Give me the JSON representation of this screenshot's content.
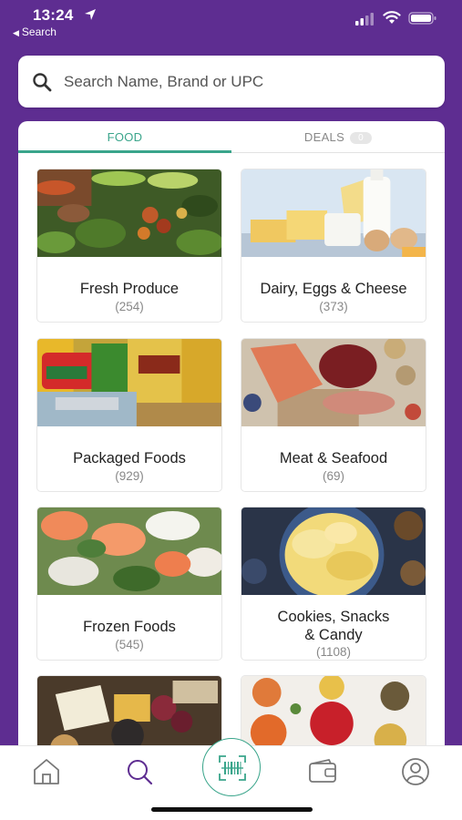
{
  "status": {
    "time": "13:24",
    "back_label": "Search"
  },
  "search": {
    "placeholder": "Search Name, Brand or UPC",
    "value": ""
  },
  "tabs": [
    {
      "label": "FOOD",
      "active": true
    },
    {
      "label": "DEALS",
      "badge": "0",
      "active": false
    }
  ],
  "categories": [
    {
      "title": "Fresh Produce",
      "count": "(254)"
    },
    {
      "title": "Dairy, Eggs & Cheese",
      "count": "(373)"
    },
    {
      "title": "Packaged Foods",
      "count": "(929)"
    },
    {
      "title": "Meat & Seafood",
      "count": "(69)"
    },
    {
      "title": "Frozen Foods",
      "count": "(545)"
    },
    {
      "title_line1": "Cookies, Snacks",
      "title_line2": "& Candy",
      "count": "(1108)"
    },
    {
      "title": "",
      "count": ""
    },
    {
      "title": "",
      "count": ""
    }
  ],
  "bottom_nav": [
    {
      "icon": "home-icon"
    },
    {
      "icon": "search-icon",
      "active": true
    },
    {
      "icon": "barcode-scan-icon"
    },
    {
      "icon": "wallet-icon"
    },
    {
      "icon": "profile-icon"
    }
  ],
  "colors": {
    "brand_purple": "#5e2d91",
    "accent_green": "#3aa58b",
    "inactive_gray": "#888888"
  }
}
